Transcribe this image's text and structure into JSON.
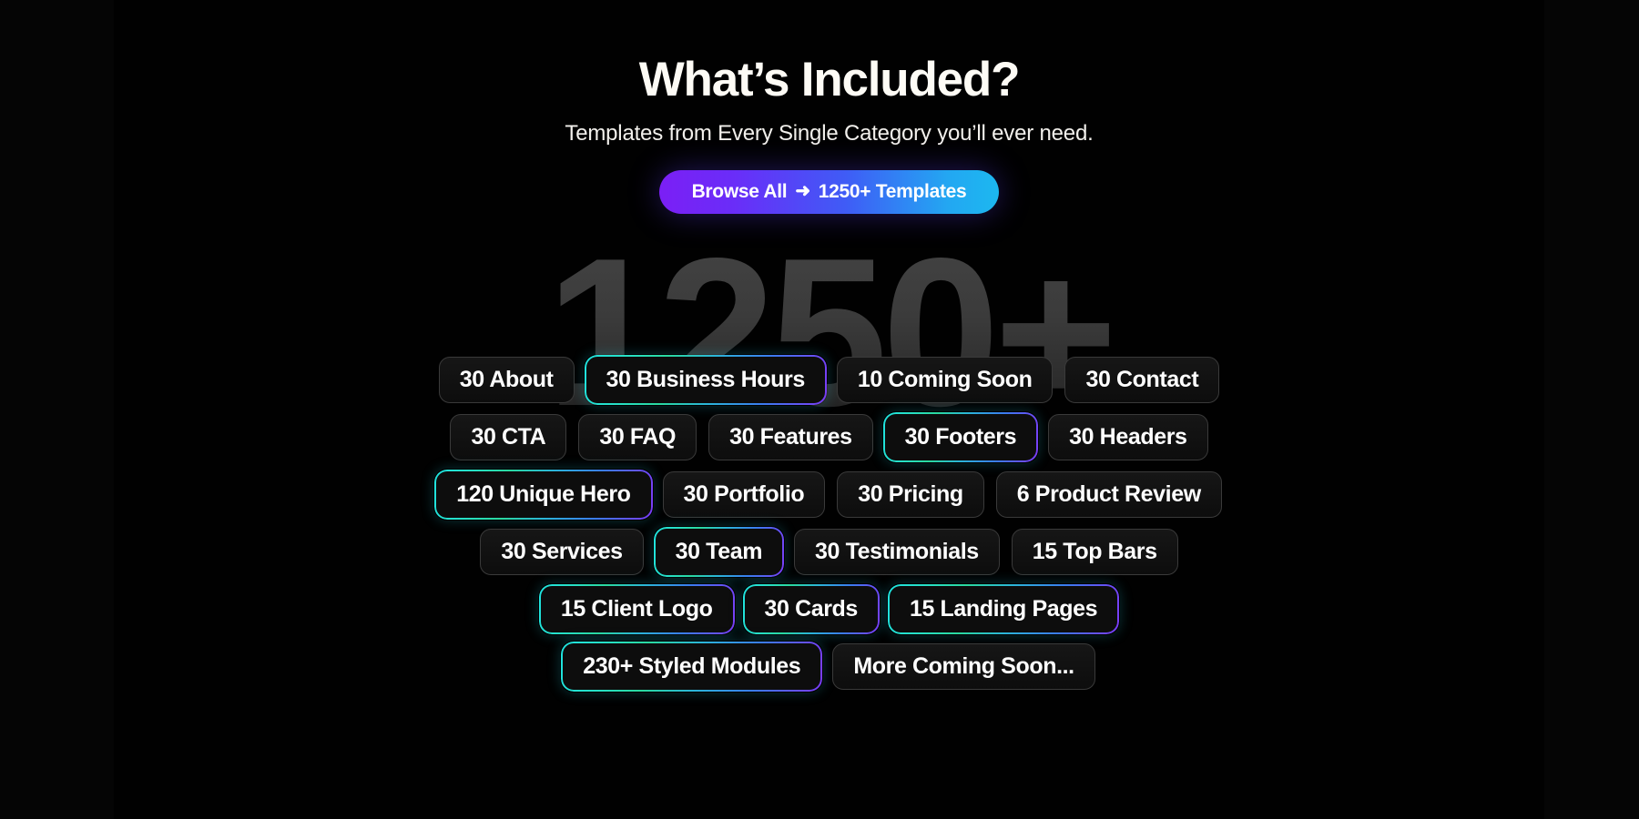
{
  "theme": {
    "background": "#000000",
    "text_primary": "#fdfbf5",
    "accent_gradient_start": "#7b1ff5",
    "accent_gradient_end": "#1cb8f0",
    "tag_border_muted": "#3a3a3a",
    "tag_border_glow_start": "#1fe3e0",
    "tag_border_glow_end": "#7b3bf7",
    "watermark_color": "#3a3a3a"
  },
  "header": {
    "title": "What’s Included?",
    "subtitle": "Templates from Every Single Category you’ll ever need.",
    "cta": {
      "label_before": "Browse All",
      "arrow": "➜",
      "label_after": "1250+ Templates"
    }
  },
  "watermark": {
    "text": "1250+"
  },
  "tag_rows": [
    {
      "tags": [
        {
          "label": "30 About",
          "style": "plain"
        },
        {
          "label": "30 Business Hours",
          "style": "glow"
        },
        {
          "label": "10 Coming Soon",
          "style": "plain"
        },
        {
          "label": "30 Contact",
          "style": "plain"
        }
      ]
    },
    {
      "tags": [
        {
          "label": "30 CTA",
          "style": "plain"
        },
        {
          "label": "30 FAQ",
          "style": "plain"
        },
        {
          "label": "30 Features",
          "style": "plain"
        },
        {
          "label": "30 Footers",
          "style": "glow"
        },
        {
          "label": "30 Headers",
          "style": "plain"
        }
      ]
    },
    {
      "tags": [
        {
          "label": "120 Unique Hero",
          "style": "glow"
        },
        {
          "label": "30 Portfolio",
          "style": "plain"
        },
        {
          "label": "30 Pricing",
          "style": "plain"
        },
        {
          "label": "6 Product Review",
          "style": "plain"
        }
      ]
    },
    {
      "tags": [
        {
          "label": "30 Services",
          "style": "plain"
        },
        {
          "label": "30 Team",
          "style": "glow"
        },
        {
          "label": "30 Testimonials",
          "style": "plain"
        },
        {
          "label": "15 Top Bars",
          "style": "plain"
        }
      ]
    },
    {
      "tags": [
        {
          "label": "15 Client Logo",
          "style": "glow"
        },
        {
          "label": "30 Cards",
          "style": "glow"
        },
        {
          "label": "15 Landing Pages",
          "style": "glow"
        }
      ]
    },
    {
      "tags": [
        {
          "label": "230+ Styled Modules",
          "style": "glow"
        },
        {
          "label": "More Coming Soon...",
          "style": "plain"
        }
      ]
    }
  ]
}
